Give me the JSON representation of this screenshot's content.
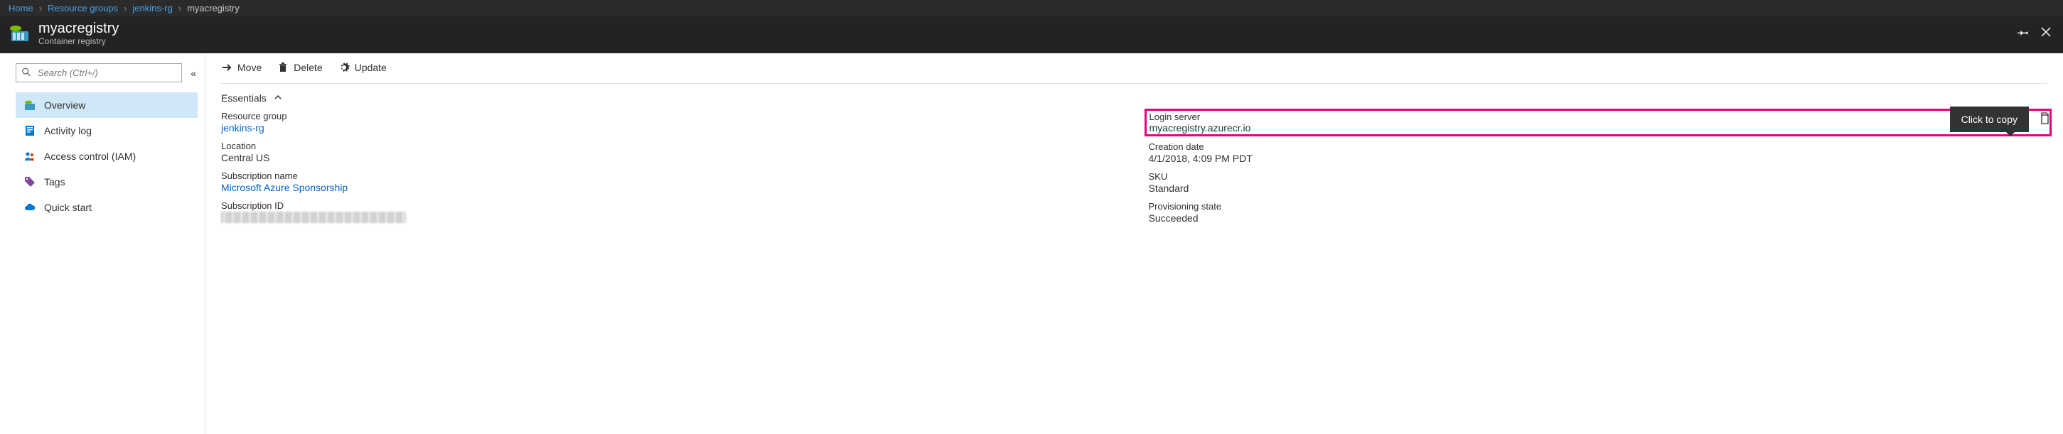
{
  "breadcrumb": {
    "items": [
      {
        "label": "Home",
        "link": true
      },
      {
        "label": "Resource groups",
        "link": true
      },
      {
        "label": "jenkins-rg",
        "link": true
      },
      {
        "label": "myacregistry",
        "link": false
      }
    ]
  },
  "header": {
    "title": "myacregistry",
    "subtitle": "Container registry"
  },
  "search": {
    "placeholder": "Search (Ctrl+/)"
  },
  "sidebar": {
    "items": [
      {
        "label": "Overview",
        "icon": "registry-icon",
        "active": true
      },
      {
        "label": "Activity log",
        "icon": "log-icon"
      },
      {
        "label": "Access control (IAM)",
        "icon": "people-icon"
      },
      {
        "label": "Tags",
        "icon": "tag-icon"
      },
      {
        "label": "Quick start",
        "icon": "cloud-icon"
      }
    ]
  },
  "toolbar": {
    "move_label": "Move",
    "delete_label": "Delete",
    "update_label": "Update"
  },
  "essentials": {
    "header": "Essentials",
    "left": {
      "resource_group_label": "Resource group",
      "resource_group_value": "jenkins-rg",
      "location_label": "Location",
      "location_value": "Central US",
      "subscription_name_label": "Subscription name",
      "subscription_name_value": "Microsoft Azure Sponsorship",
      "subscription_id_label": "Subscription ID"
    },
    "right": {
      "login_server_label": "Login server",
      "login_server_value": "myacregistry.azurecr.io",
      "creation_date_label": "Creation date",
      "creation_date_value": "4/1/2018, 4:09 PM PDT",
      "sku_label": "SKU",
      "sku_value": "Standard",
      "provisioning_state_label": "Provisioning state",
      "provisioning_state_value": "Succeeded"
    }
  },
  "tooltip": {
    "text": "Click to copy"
  }
}
